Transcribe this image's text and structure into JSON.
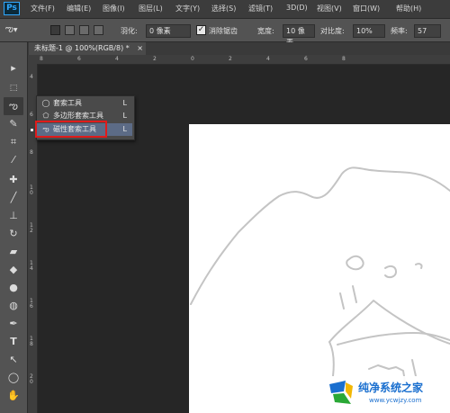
{
  "app": {
    "logo": "Ps"
  },
  "menu": [
    "文件(F)",
    "编辑(E)",
    "图像(I)",
    "图层(L)",
    "文字(Y)",
    "选择(S)",
    "滤镜(T)",
    "3D(D)",
    "视图(V)",
    "窗口(W)",
    "帮助(H)"
  ],
  "options": {
    "feather_label": "羽化:",
    "feather_value": "0 像素",
    "antialias_label": "消除锯齿",
    "width_label": "宽度:",
    "width_value": "10 像素",
    "contrast_label": "对比度:",
    "contrast_value": "10%",
    "frequency_label": "频率:",
    "frequency_value": "57"
  },
  "document": {
    "tab_title": "未标题-1 @ 100%(RGB/8) *",
    "close": "×"
  },
  "rulers": {
    "h": [
      "8",
      "6",
      "4",
      "2",
      "0",
      "2",
      "4",
      "6",
      "8"
    ],
    "v": [
      "4",
      "6",
      "8",
      "1\n0",
      "1\n2",
      "1\n4",
      "1\n6",
      "1\n8",
      "2\n0"
    ]
  },
  "flyout": {
    "items": [
      {
        "label": "套索工具",
        "key": "L",
        "icon": "lasso-icon"
      },
      {
        "label": "多边形套索工具",
        "key": "L",
        "icon": "polygonal-lasso-icon"
      },
      {
        "label": "磁性套索工具",
        "key": "L",
        "icon": "magnetic-lasso-icon"
      }
    ]
  },
  "watermark": {
    "text": "纯净系统之家",
    "url": "www.ycwjzy.com"
  }
}
